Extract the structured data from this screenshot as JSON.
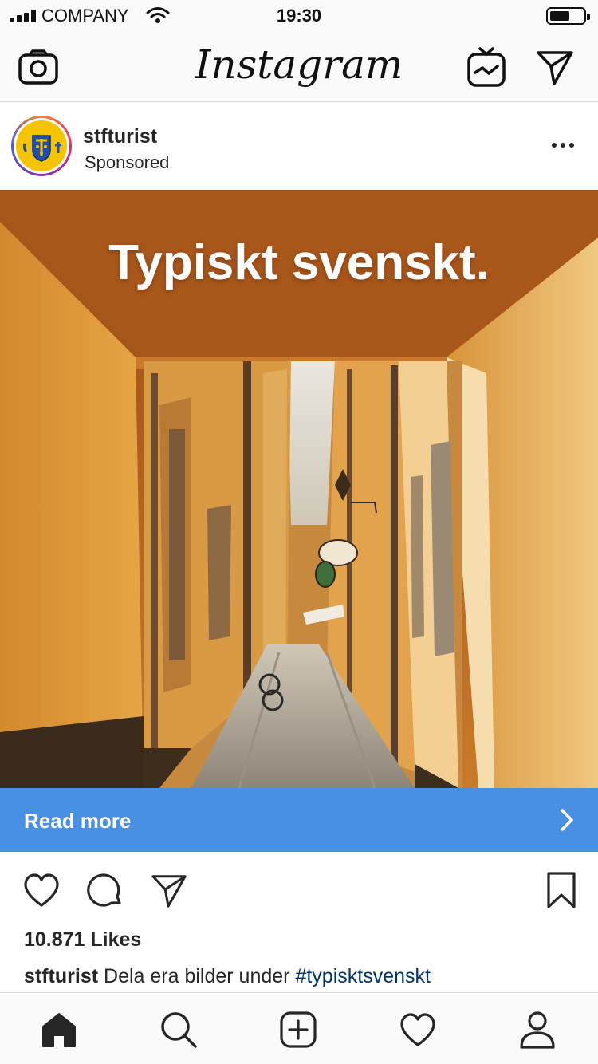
{
  "status_bar": {
    "carrier": "COMPANY",
    "time": "19:30",
    "battery_level": 0.6
  },
  "top_nav": {
    "logo_text": "Instagram",
    "icons": [
      "camera-icon",
      "igtv-icon",
      "direct-message-icon"
    ]
  },
  "post": {
    "username": "stfturist",
    "subtitle": "Sponsored",
    "image": {
      "headline": "Typiskt svenskt."
    },
    "cta": {
      "label": "Read more",
      "color": "#4a90e2"
    },
    "likes_text": "10.871 Likes",
    "caption": {
      "username": "stfturist",
      "text": " Dela era bilder under ",
      "hashtag": "#typisktsvenskt",
      "hashtag_color": "#00376b"
    },
    "action_icons": [
      "heart-icon",
      "comment-icon",
      "share-icon",
      "bookmark-icon"
    ]
  },
  "tab_bar": {
    "items": [
      "home-icon",
      "search-icon",
      "new-post-icon",
      "activity-icon",
      "profile-icon"
    ],
    "active": "home-icon"
  }
}
